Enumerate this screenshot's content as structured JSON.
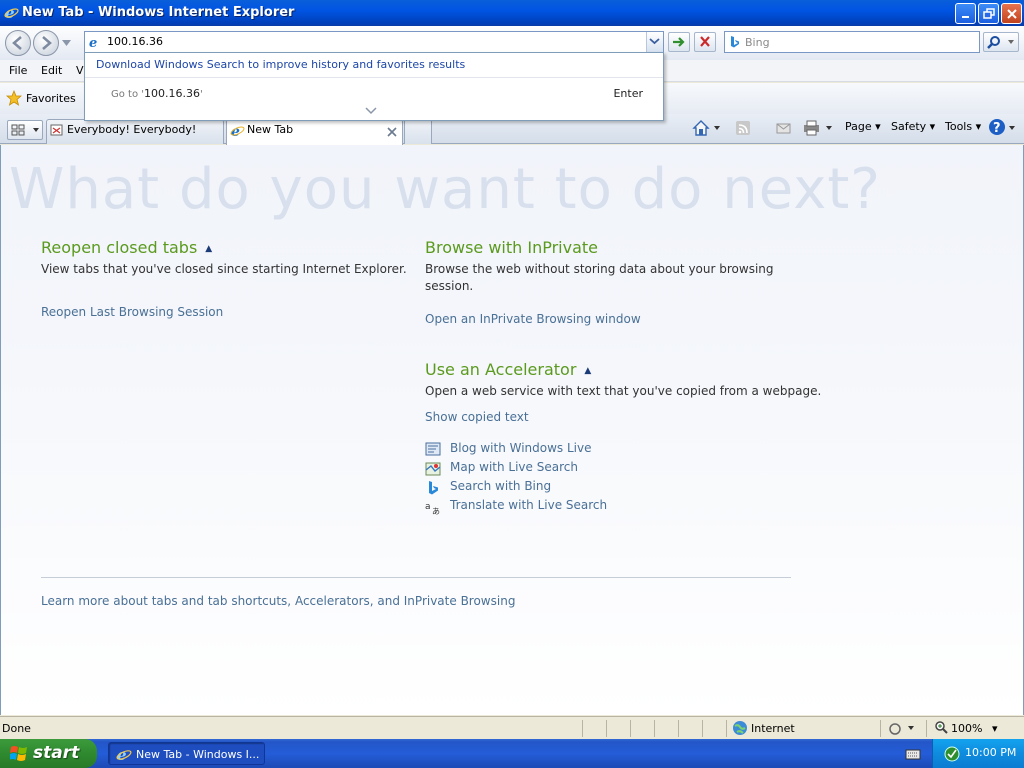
{
  "window": {
    "title": "New Tab - Windows Internet Explorer"
  },
  "address_bar": {
    "value": "100.16.36"
  },
  "search_box": {
    "placeholder": "Bing"
  },
  "menu": {
    "items": [
      "File",
      "Edit",
      "Vi"
    ]
  },
  "favorites_bar": {
    "label": "Favorites"
  },
  "suggest": {
    "download_link": "Download Windows Search to improve history and favorites results",
    "goto_prefix": "Go to '",
    "goto_value": "100.16.36",
    "goto_suffix": "'",
    "enter_label": "Enter"
  },
  "tabs": [
    {
      "label": "Everybody! Everybody!"
    },
    {
      "label": "New Tab"
    }
  ],
  "command_bar": {
    "page": "Page",
    "safety": "Safety",
    "tools": "Tools"
  },
  "content": {
    "hero": "What do you want to do next?",
    "reopen": {
      "title": "Reopen closed tabs",
      "text": "View tabs that you've closed since starting Internet Explorer.",
      "link": "Reopen Last Browsing Session"
    },
    "inprivate": {
      "title": "Browse with InPrivate",
      "text": "Browse the web without storing data about your browsing session.",
      "link": "Open an InPrivate Browsing window"
    },
    "accelerator": {
      "title": "Use an Accelerator",
      "text": "Open a web service with text that you've copied from a webpage.",
      "show_link": "Show copied text",
      "items": [
        "Blog with Windows Live",
        "Map with Live Search",
        "Search with Bing",
        "Translate with Live Search"
      ]
    },
    "footer_link": "Learn more about tabs and tab shortcuts, Accelerators, and InPrivate Browsing"
  },
  "status_bar": {
    "status": "Done",
    "zone": "Internet",
    "zoom": "100%"
  },
  "taskbar": {
    "start": "start",
    "item": "New Tab - Windows I...",
    "clock": "10:00 PM"
  }
}
